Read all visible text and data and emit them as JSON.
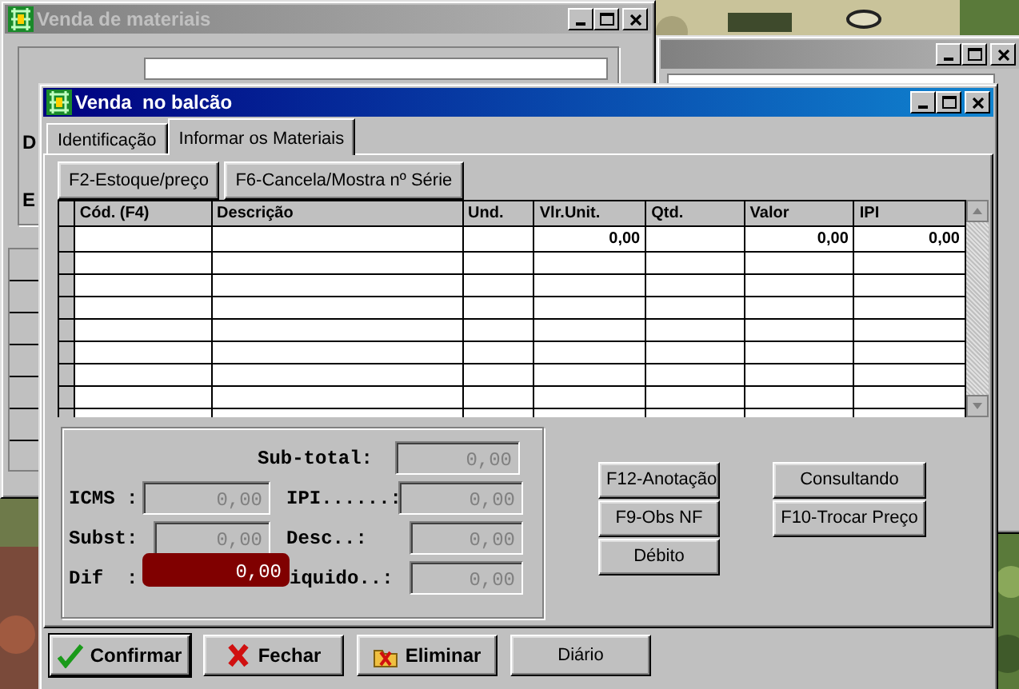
{
  "back_window": {
    "title": "Venda de materiais",
    "field_labels": [
      "D",
      "E"
    ]
  },
  "window": {
    "title": "Venda  no balcão"
  },
  "tabs": [
    {
      "label": "Identificação",
      "selected": false
    },
    {
      "label": "Informar os Materiais",
      "selected": true
    }
  ],
  "toolbar_buttons": [
    "F2-Estoque/preço",
    "F6-Cancela/Mostra nº Série"
  ],
  "table": {
    "columns": [
      {
        "label": "Cód. (F4)"
      },
      {
        "label": "Descrição"
      },
      {
        "label": "Und."
      },
      {
        "label": "Vlr.Unit."
      },
      {
        "label": "Qtd."
      },
      {
        "label": "Valor"
      },
      {
        "label": "IPI"
      }
    ],
    "rows": [
      {
        "cells": [
          null,
          null,
          null,
          "0,00",
          null,
          "0,00",
          "0,00"
        ]
      }
    ]
  },
  "totals": {
    "sub_total": {
      "label": "Sub-total:",
      "value": "0,00",
      "disabled": true,
      "highlighted": false
    },
    "icms": {
      "label": "ICMS :",
      "value": "0,00",
      "disabled": true,
      "highlighted": false
    },
    "ipi": {
      "label": "IPI......:",
      "value": "0,00",
      "disabled": true,
      "highlighted": false
    },
    "subst": {
      "label": "Subst:",
      "value": "0,00",
      "disabled": true,
      "highlighted": false
    },
    "desc": {
      "label": "Desc..:",
      "value": "0,00",
      "disabled": true,
      "highlighted": false
    },
    "dif": {
      "label": "Dif  :",
      "value": "0,00",
      "disabled": false,
      "highlighted": true
    },
    "liquido": {
      "label": "iquido..:",
      "value": "0,00",
      "disabled": true,
      "highlighted": false
    }
  },
  "side_buttons": {
    "column_1": [
      "F12-Anotação",
      "F9-Obs NF",
      "Débito"
    ],
    "column_2": [
      "Consultando",
      "F10-Trocar Preço"
    ]
  },
  "footer_buttons": [
    {
      "label": "Confirmar",
      "kind": "check",
      "default": true
    },
    {
      "label": "Fechar",
      "kind": "cross",
      "default": false
    },
    {
      "label": "Eliminar",
      "kind": "folder",
      "default": false
    },
    {
      "label": "Diário",
      "kind": "plain",
      "default": false
    }
  ]
}
